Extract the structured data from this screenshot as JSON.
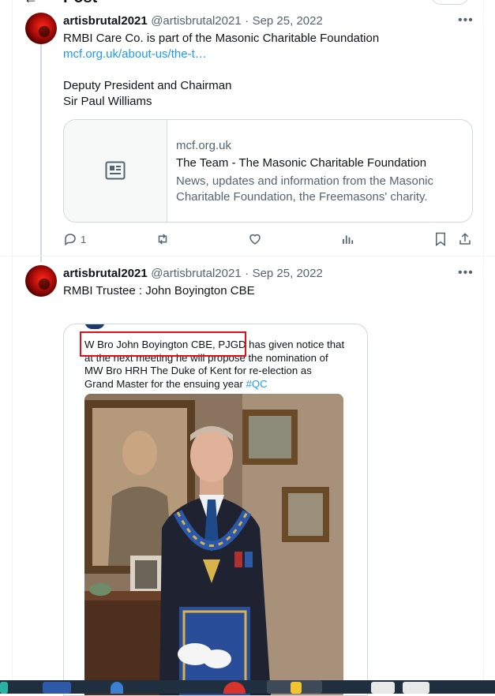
{
  "header": {
    "title": "Post"
  },
  "tweets": [
    {
      "name": "artisbrutal2021",
      "handle": "@artisbrutal2021",
      "date": "Sep 25, 2022",
      "line1": "RMBI Care Co. is part of the Masonic Charitable Foundation",
      "link": "mcf.org.uk/about-us/the-t…",
      "line2": "Deputy President and Chairman",
      "line3": "Sir Paul Williams",
      "card": {
        "domain": "mcf.org.uk",
        "title": "The Team - The Masonic Charitable Foundation",
        "description_line1": "News, updates and information from the Masonic",
        "description_line2": "Charitable Foundation, the Freemasons' charity."
      },
      "actions": {
        "reply_count": "1"
      }
    },
    {
      "name": "artisbrutal2021",
      "handle": "@artisbrutal2021",
      "date": "Sep 25, 2022",
      "text": "RMBI Trustee : John Boyington CBE",
      "embed": {
        "highlight": "W Bro John Boyington CBE, PJGD",
        "rest_line1": " has given notice that",
        "line2": "at the next meeting he will propose the nomination of",
        "line3": "MW Bro HRH The Duke of Kent for re-election as",
        "line4": "Grand Master for the ensuing year ",
        "hashtag": "#QC"
      }
    }
  ],
  "colors": {
    "link": "#1d9bf0",
    "muted": "#536471",
    "highlight_box": "#e0101a",
    "taskbar": "#1f2f3f"
  }
}
